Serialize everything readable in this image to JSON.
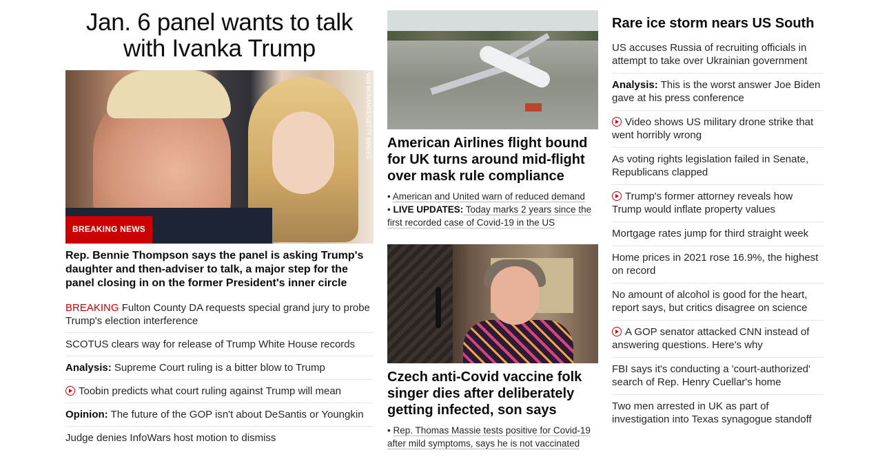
{
  "lead": {
    "title": "Jan. 6 panel wants to talk with Ivanka Trump",
    "photo_credit": "WIN MCNAMEE/GETTY IMAGES",
    "badge": "BREAKING NEWS",
    "description": "Rep. Bennie Thompson says the panel is asking Trump's daughter and then-adviser to talk, a major step for the panel closing in on the former President's inner circle"
  },
  "left_links": [
    {
      "prefix": "BREAKING",
      "prefix_style": "red",
      "text": " Fulton County DA requests special grand jury to probe Trump's election interference",
      "video": false
    },
    {
      "prefix": "",
      "text": "SCOTUS clears way for release of Trump White House records",
      "video": false
    },
    {
      "prefix": "Analysis:",
      "prefix_style": "bold",
      "text": " Supreme Court ruling is a bitter blow to Trump",
      "video": false
    },
    {
      "prefix": "",
      "text": "Toobin predicts what court ruling against Trump will mean",
      "video": true
    },
    {
      "prefix": "Opinion:",
      "prefix_style": "bold",
      "text": " The future of the GOP isn't about DeSantis or Youngkin",
      "video": false
    },
    {
      "prefix": "",
      "text": "Judge denies InfoWars host motion to dismiss",
      "video": false
    }
  ],
  "story1": {
    "title": "American Airlines flight bound for UK turns around mid-flight over mask rule compliance",
    "bullets": [
      {
        "label": "",
        "text": "American and United warn of reduced demand"
      },
      {
        "label": "LIVE UPDATES:",
        "text": " Today marks 2 years since the first recorded case of Covid-19 in the US"
      }
    ]
  },
  "story2": {
    "title": "Czech anti-Covid vaccine folk singer dies after deliberately getting infected, son says",
    "bullets": [
      {
        "label": "",
        "text": "Rep. Thomas Massie tests positive for Covid-19 after mild symptoms, says he is not vaccinated"
      }
    ]
  },
  "right": {
    "headline": "Rare ice storm nears US South",
    "links": [
      {
        "prefix": "",
        "text": "US accuses Russia of recruiting officials in attempt to take over Ukrainian government",
        "video": false
      },
      {
        "prefix": "Analysis:",
        "text": " This is the worst answer Joe Biden gave at his press conference",
        "video": false
      },
      {
        "prefix": "",
        "text": "Video shows US military drone strike that went horribly wrong",
        "video": true
      },
      {
        "prefix": "",
        "text": "As voting rights legislation failed in Senate, Republicans clapped",
        "video": false
      },
      {
        "prefix": "",
        "text": "Trump's former attorney reveals how Trump would inflate property values",
        "video": true
      },
      {
        "prefix": "",
        "text": "Mortgage rates jump for third straight week",
        "video": false
      },
      {
        "prefix": "",
        "text": "Home prices in 2021 rose 16.9%, the highest on record",
        "video": false
      },
      {
        "prefix": "",
        "text": "No amount of alcohol is good for the heart, report says, but critics disagree on science",
        "video": false
      },
      {
        "prefix": "",
        "text": "A GOP senator attacked CNN instead of answering questions. Here's why",
        "video": true
      },
      {
        "prefix": "",
        "text": "FBI says it's conducting a 'court-authorized' search of Rep. Henry Cuellar's home",
        "video": false
      },
      {
        "prefix": "",
        "text": "Two men arrested in UK as part of investigation into Texas synagogue standoff",
        "video": false
      }
    ]
  },
  "colors": {
    "breaking_red": "#cc0000",
    "text": "#0c0c0c",
    "divider": "#e6e6e6"
  },
  "icons": {
    "video": "play-circle-icon"
  }
}
